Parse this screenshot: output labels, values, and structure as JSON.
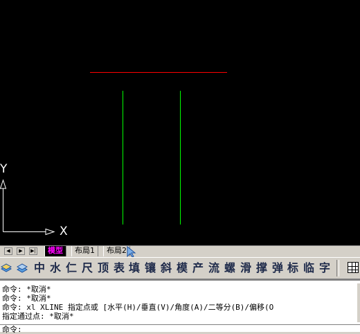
{
  "canvas": {
    "background": "#000000",
    "ucs": {
      "x_label": "X",
      "y_label": "Y"
    },
    "lines": [
      {
        "name": "red-xline",
        "color": "#ff0000"
      },
      {
        "name": "green-line-left",
        "color": "#00ff00"
      },
      {
        "name": "green-line-right",
        "color": "#00ff00"
      }
    ]
  },
  "layout_tabs": {
    "nav": [
      "◀",
      "▶",
      "▶|"
    ],
    "tabs": [
      {
        "label": "模型",
        "active": true
      },
      {
        "label": "布局1",
        "active": false
      },
      {
        "label": "布局2",
        "active": false
      }
    ]
  },
  "toolbar": {
    "icons": [
      "layers-icon",
      "layer-state-icon"
    ],
    "chars": [
      "中",
      "水",
      "仁",
      "尺",
      "顶",
      "表",
      "填",
      "镶",
      "斜",
      "模",
      "产",
      "流",
      "螺",
      "滑",
      "撑",
      "弹",
      "标",
      "临",
      "字"
    ],
    "grid_icon": "table-icon"
  },
  "command": {
    "history": [
      "命令: *取消*",
      "命令: *取消*",
      "命令: xl XLINE 指定点或 [水平(H)/垂直(V)/角度(A)/二等分(B)/偏移(O",
      "指定通过点: *取消*"
    ],
    "prompt": "命令:"
  }
}
